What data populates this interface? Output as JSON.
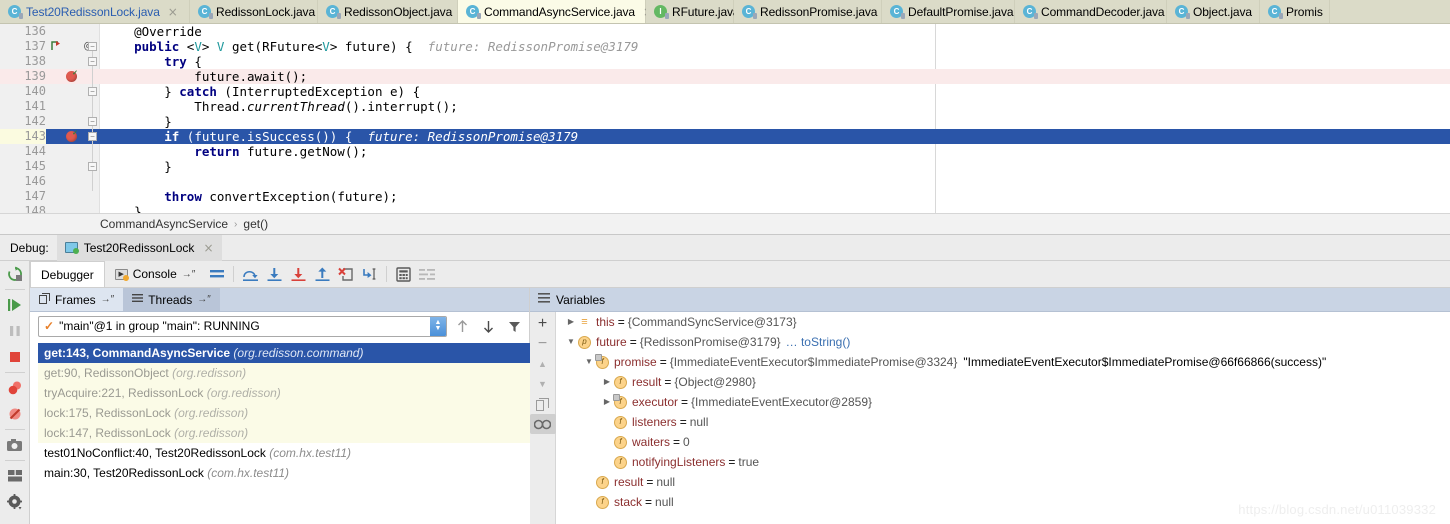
{
  "editor_tabs": [
    {
      "label": "Test20RedissonLock.java",
      "icon": "java-class-icon",
      "kind": "c",
      "active": false,
      "modified": true
    },
    {
      "label": "RedissonLock.java",
      "icon": "java-class-icon",
      "kind": "c",
      "active": false,
      "modified": false
    },
    {
      "label": "RedissonObject.java",
      "icon": "java-class-icon",
      "kind": "c",
      "active": false,
      "modified": false
    },
    {
      "label": "CommandAsyncService.java",
      "icon": "java-class-icon",
      "kind": "c",
      "active": true,
      "modified": false
    },
    {
      "label": "RFuture.java",
      "icon": "java-interface-icon",
      "kind": "i",
      "active": false,
      "modified": false
    },
    {
      "label": "RedissonPromise.java",
      "icon": "java-class-icon",
      "kind": "c",
      "active": false,
      "modified": false
    },
    {
      "label": "DefaultPromise.java",
      "icon": "java-class-icon",
      "kind": "c",
      "active": false,
      "modified": false
    },
    {
      "label": "CommandDecoder.java",
      "icon": "java-class-icon",
      "kind": "c",
      "active": false,
      "modified": false
    },
    {
      "label": "Object.java",
      "icon": "java-class-icon",
      "kind": "c",
      "active": false,
      "modified": false
    },
    {
      "label": "Promis",
      "icon": "java-class-icon",
      "kind": "c",
      "active": false,
      "modified": false
    }
  ],
  "tab_close_glyph": "×",
  "code": {
    "lines": [
      {
        "num": "136",
        "indent": 0,
        "state": "normal",
        "tokens": [
          {
            "t": "    @Override",
            "c": "plain"
          }
        ]
      },
      {
        "num": "137",
        "indent": 0,
        "state": "normal",
        "override_mark": true,
        "at_mark": "@",
        "fold": "-",
        "tokens": [
          {
            "t": "    ",
            "c": "plain"
          },
          {
            "t": "public",
            "c": "kw"
          },
          {
            "t": " <",
            "c": "plain"
          },
          {
            "t": "V",
            "c": "gen"
          },
          {
            "t": "> ",
            "c": "plain"
          },
          {
            "t": "V",
            "c": "gen"
          },
          {
            "t": " get(RFuture<",
            "c": "plain"
          },
          {
            "t": "V",
            "c": "gen"
          },
          {
            "t": "> future) {  ",
            "c": "plain"
          },
          {
            "t": "future: RedissonPromise@3179",
            "c": "hint"
          }
        ]
      },
      {
        "num": "138",
        "indent": 0,
        "state": "normal",
        "fold": "-",
        "tokens": [
          {
            "t": "        ",
            "c": "plain"
          },
          {
            "t": "try",
            "c": "kw"
          },
          {
            "t": " {",
            "c": "plain"
          }
        ]
      },
      {
        "num": "139",
        "indent": 0,
        "state": "breakpoint",
        "breakpoint": true,
        "tokens": [
          {
            "t": "            future.await();",
            "c": "plain"
          }
        ]
      },
      {
        "num": "140",
        "indent": 0,
        "state": "normal",
        "fold": "-",
        "tokens": [
          {
            "t": "        } ",
            "c": "plain"
          },
          {
            "t": "catch",
            "c": "kw"
          },
          {
            "t": " (InterruptedException e) {",
            "c": "plain"
          }
        ]
      },
      {
        "num": "141",
        "indent": 0,
        "state": "normal",
        "tokens": [
          {
            "t": "            Thread.",
            "c": "plain"
          },
          {
            "t": "currentThread",
            "c": "ital"
          },
          {
            "t": "().interrupt();",
            "c": "plain"
          }
        ]
      },
      {
        "num": "142",
        "indent": 0,
        "state": "normal",
        "fold": "-",
        "tokens": [
          {
            "t": "        }",
            "c": "plain"
          }
        ]
      },
      {
        "num": "143",
        "indent": 0,
        "state": "executing",
        "breakpoint": true,
        "fold": "-",
        "tokens": [
          {
            "t": "        ",
            "c": "plain"
          },
          {
            "t": "if",
            "c": "kw"
          },
          {
            "t": " (future.isSuccess()) {  ",
            "c": "plain"
          },
          {
            "t": "future: RedissonPromise@3179",
            "c": "hint"
          }
        ]
      },
      {
        "num": "144",
        "indent": 0,
        "state": "normal",
        "tokens": [
          {
            "t": "            ",
            "c": "plain"
          },
          {
            "t": "return",
            "c": "kw"
          },
          {
            "t": " future.getNow();",
            "c": "plain"
          }
        ]
      },
      {
        "num": "145",
        "indent": 0,
        "state": "normal",
        "fold": "-",
        "tokens": [
          {
            "t": "        }",
            "c": "plain"
          }
        ]
      },
      {
        "num": "146",
        "indent": 0,
        "state": "normal",
        "tokens": [
          {
            "t": "",
            "c": "plain"
          }
        ]
      },
      {
        "num": "147",
        "indent": 0,
        "state": "normal",
        "tokens": [
          {
            "t": "        ",
            "c": "plain"
          },
          {
            "t": "throw",
            "c": "kw"
          },
          {
            "t": " convertException(future);",
            "c": "plain"
          }
        ]
      },
      {
        "num": "148",
        "indent": 0,
        "state": "normal",
        "tokens": [
          {
            "t": "    }",
            "c": "plain"
          }
        ]
      }
    ]
  },
  "breadcrumb": {
    "class": "CommandAsyncService",
    "separator": "›",
    "method": "get()"
  },
  "debug_header": {
    "label": "Debug:",
    "run_config": "Test20RedissonLock",
    "close_glyph": "×"
  },
  "sidebar": [
    {
      "name": "rerun-icon",
      "glyph": "↻"
    },
    {
      "sep": true
    },
    {
      "name": "resume-program-icon",
      "glyph": "▶"
    },
    {
      "name": "pause-program-icon",
      "glyph": "‖"
    },
    {
      "name": "stop-icon",
      "glyph": "■"
    },
    {
      "sep": true
    },
    {
      "name": "view-breakpoints-icon",
      "glyph": "●"
    },
    {
      "name": "mute-breakpoints-icon",
      "glyph": "⊘"
    },
    {
      "sep": true
    },
    {
      "name": "camera-snapshot-icon",
      "glyph": "▣"
    },
    {
      "sep": true
    },
    {
      "name": "layout-settings-icon",
      "glyph": "▤"
    },
    {
      "name": "settings-gear-icon",
      "glyph": "⚙"
    }
  ],
  "debugger_tabs": [
    {
      "label": "Debugger",
      "active": true,
      "icon": null
    },
    {
      "label": "Console",
      "active": false,
      "icon": "console-icon",
      "pin": "→″"
    }
  ],
  "debugger_toolbar": [
    {
      "name": "show-execution-point-icon",
      "glyph": "≡"
    },
    {
      "sep": true
    },
    {
      "name": "step-over-icon",
      "glyph": "⤵"
    },
    {
      "name": "step-into-icon",
      "glyph": "⬇"
    },
    {
      "name": "force-step-into-icon",
      "glyph": "⬇"
    },
    {
      "name": "step-out-icon",
      "glyph": "⬆"
    },
    {
      "name": "drop-frame-icon",
      "glyph": "✗"
    },
    {
      "name": "run-to-cursor-icon",
      "glyph": "↘"
    },
    {
      "sep": true
    },
    {
      "name": "evaluate-expression-icon",
      "glyph": "▦"
    },
    {
      "name": "watches-icon",
      "glyph": "≣"
    }
  ],
  "frames_panel": {
    "tabs": [
      {
        "label": "Frames",
        "icon": "frames-icon",
        "pin": "→″",
        "active": true
      },
      {
        "label": "Threads",
        "icon": "threads-icon",
        "pin": "→″",
        "active": false
      }
    ],
    "thread_selector": {
      "value": "\"main\"@1 in group \"main\": RUNNING",
      "status_icon": "check-icon",
      "status_glyph": "✓"
    },
    "thread_buttons": [
      {
        "name": "previous-frame-button",
        "glyph": "↑"
      },
      {
        "name": "next-frame-button",
        "glyph": "↓"
      },
      {
        "name": "filter-frames-button",
        "glyph": "▼"
      }
    ],
    "frames": [
      {
        "method": "get:143, CommandAsyncService",
        "package": "(org.redisson.command)",
        "state": "selected"
      },
      {
        "method": "get:90, RedissonObject",
        "package": "(org.redisson)",
        "state": "library"
      },
      {
        "method": "tryAcquire:221, RedissonLock",
        "package": "(org.redisson)",
        "state": "library"
      },
      {
        "method": "lock:175, RedissonLock",
        "package": "(org.redisson)",
        "state": "library"
      },
      {
        "method": "lock:147, RedissonLock",
        "package": "(org.redisson)",
        "state": "library"
      },
      {
        "method": "test01NoConflict:40, Test20RedissonLock",
        "package": "(com.hx.test11)",
        "state": "user"
      },
      {
        "method": "main:30, Test20RedissonLock",
        "package": "(com.hx.test11)",
        "state": "user"
      }
    ]
  },
  "variables_panel": {
    "title": "Variables",
    "title_icon": "variables-icon",
    "rail_buttons": [
      {
        "name": "add-watch-button",
        "glyph": "+",
        "active": false
      },
      {
        "name": "remove-watch-button",
        "glyph": "−",
        "active": false
      },
      {
        "name": "move-watch-up-button",
        "glyph": "▲",
        "active": false
      },
      {
        "name": "move-watch-down-button",
        "glyph": "▼",
        "active": false
      },
      {
        "name": "copy-value-button",
        "glyph": "❐",
        "active": false
      },
      {
        "name": "inspect-button",
        "glyph": "∞",
        "active": true
      }
    ],
    "rows": [
      {
        "depth": 0,
        "tri": "▶",
        "badge": "lines",
        "badge_glyph": "≡",
        "name": "this",
        "value": "{CommandSyncService@3173}",
        "link": "",
        "str": ""
      },
      {
        "depth": 0,
        "tri": "▼",
        "badge": "p",
        "badge_glyph": "p",
        "name": "future",
        "value": "{RedissonPromise@3179}",
        "link": "… toString()",
        "str": ""
      },
      {
        "depth": 1,
        "tri": "▼",
        "badge": "f-stacked",
        "badge_glyph": "f",
        "name": "promise",
        "value": "{ImmediateEventExecutor$ImmediatePromise@3324}",
        "link": "",
        "str": "\"ImmediateEventExecutor$ImmediatePromise@66f66866(success)\""
      },
      {
        "depth": 2,
        "tri": "▶",
        "badge": "f",
        "badge_glyph": "f",
        "name": "result",
        "value": "{Object@2980}",
        "link": "",
        "str": ""
      },
      {
        "depth": 2,
        "tri": "▶",
        "badge": "f-stacked",
        "badge_glyph": "f",
        "name": "executor",
        "value": "{ImmediateEventExecutor@2859}",
        "link": "",
        "str": ""
      },
      {
        "depth": 2,
        "tri": "",
        "badge": "f",
        "badge_glyph": "f",
        "name": "listeners",
        "value": "null",
        "link": "",
        "str": ""
      },
      {
        "depth": 2,
        "tri": "",
        "badge": "f",
        "badge_glyph": "f",
        "name": "waiters",
        "value": "0",
        "link": "",
        "str": ""
      },
      {
        "depth": 2,
        "tri": "",
        "badge": "f",
        "badge_glyph": "f",
        "name": "notifyingListeners",
        "value": "true",
        "link": "",
        "str": ""
      },
      {
        "depth": 1,
        "tri": "",
        "badge": "f",
        "badge_glyph": "f",
        "name": "result",
        "value": "null",
        "link": "",
        "str": ""
      },
      {
        "depth": 1,
        "tri": "",
        "badge": "f",
        "badge_glyph": "f",
        "name": "stack",
        "value": "null",
        "link": "",
        "str": ""
      }
    ]
  },
  "watermark": "https://blog.csdn.net/u011039332",
  "colors": {
    "execution_highlight": "#2a55a8",
    "breakpoint_line": "#faeaea",
    "tab_active": "#fbfbe7",
    "tab_bar": "#dbdbc8",
    "panel_header": "#c9d4e4",
    "library_frame": "#fbfbe7",
    "variable_name": "#8b2f2f"
  }
}
